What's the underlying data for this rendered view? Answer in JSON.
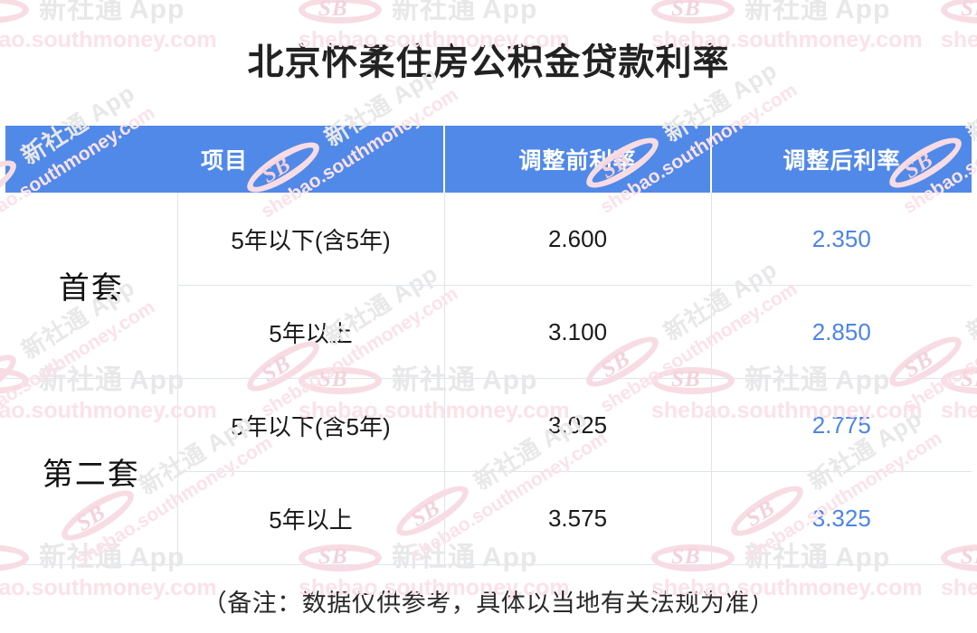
{
  "page": {
    "title": "北京怀柔住房公积金贷款利率",
    "footer_note": "（备注：数据仅供参考，具体以当地有关法规为准）"
  },
  "colors": {
    "header_blue": "#5189E8",
    "adjusted_value_blue": "#4D84E8",
    "border": "#DDE3F4",
    "text": "#1A1A1A",
    "watermark_pink": "#FBE2E9",
    "watermark_gray": "#E8E8E8"
  },
  "watermark": {
    "brand_cn": "新社通",
    "brand_en": "App",
    "logo_text": "SB",
    "site": "shebao.southmoney.com"
  },
  "table": {
    "headers": {
      "group": "",
      "item": "项目",
      "before": "调整前利率",
      "after": "调整后利率"
    },
    "groups": [
      {
        "label": "首套",
        "rows": [
          {
            "item": "5年以下(含5年)",
            "before": "2.600",
            "after": "2.350"
          },
          {
            "item": "5年以上",
            "before": "3.100",
            "after": "2.850"
          }
        ]
      },
      {
        "label": "第二套",
        "rows": [
          {
            "item": "5年以下(含5年)",
            "before": "3.025",
            "after": "2.775"
          },
          {
            "item": "5年以上",
            "before": "3.575",
            "after": "3.325"
          }
        ]
      }
    ]
  },
  "chart_data": {
    "type": "table",
    "title": "北京怀柔住房公积金贷款利率",
    "columns": [
      "项目",
      "调整前利率",
      "调整后利率"
    ],
    "rows": [
      {
        "category": "首套",
        "term": "5年以下(含5年)",
        "before": 2.6,
        "after": 2.35
      },
      {
        "category": "首套",
        "term": "5年以上",
        "before": 3.1,
        "after": 2.85
      },
      {
        "category": "第二套",
        "term": "5年以下(含5年)",
        "before": 3.025,
        "after": 2.775
      },
      {
        "category": "第二套",
        "term": "5年以上",
        "before": 3.575,
        "after": 3.325
      }
    ],
    "unit": "%",
    "note": "（备注：数据仅供参考，具体以当地有关法规为准）"
  }
}
